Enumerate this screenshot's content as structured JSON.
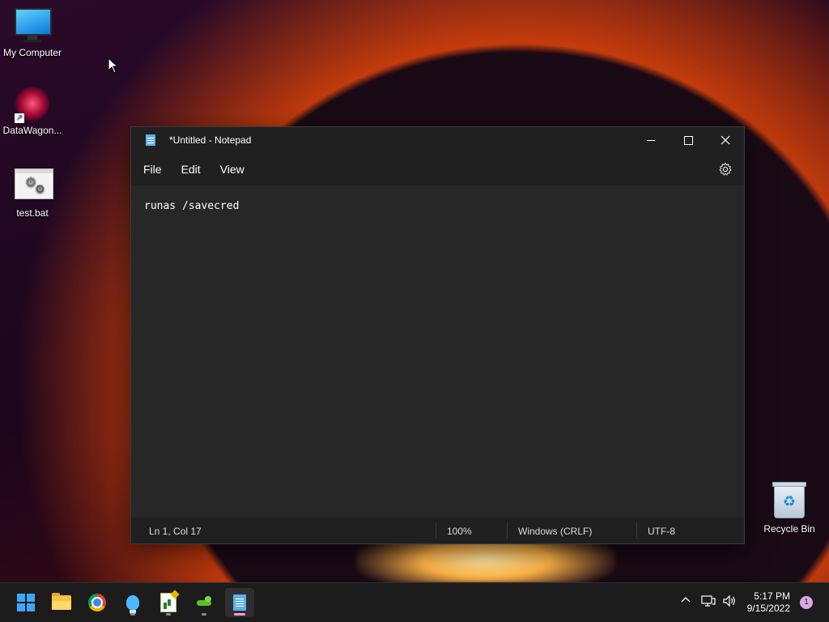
{
  "desktop": {
    "icons": [
      {
        "label": "My Computer"
      },
      {
        "label": "DataWagon..."
      },
      {
        "label": "test.bat"
      },
      {
        "label": "Recycle Bin"
      }
    ]
  },
  "notepad": {
    "title": "*Untitled - Notepad",
    "menu": {
      "file": "File",
      "edit": "Edit",
      "view": "View"
    },
    "content": "runas /savecred",
    "status": {
      "position": "Ln 1, Col 17",
      "zoom": "100%",
      "line_ending": "Windows (CRLF)",
      "encoding": "UTF-8"
    }
  },
  "taskbar": {
    "time": "5:17 PM",
    "date": "9/15/2022",
    "notification_count": "1"
  },
  "icons": {
    "close": "close-icon",
    "settings": "gear-icon",
    "tray_chevron": "chevron-up-icon",
    "network": "network-icon",
    "volume": "volume-icon"
  }
}
